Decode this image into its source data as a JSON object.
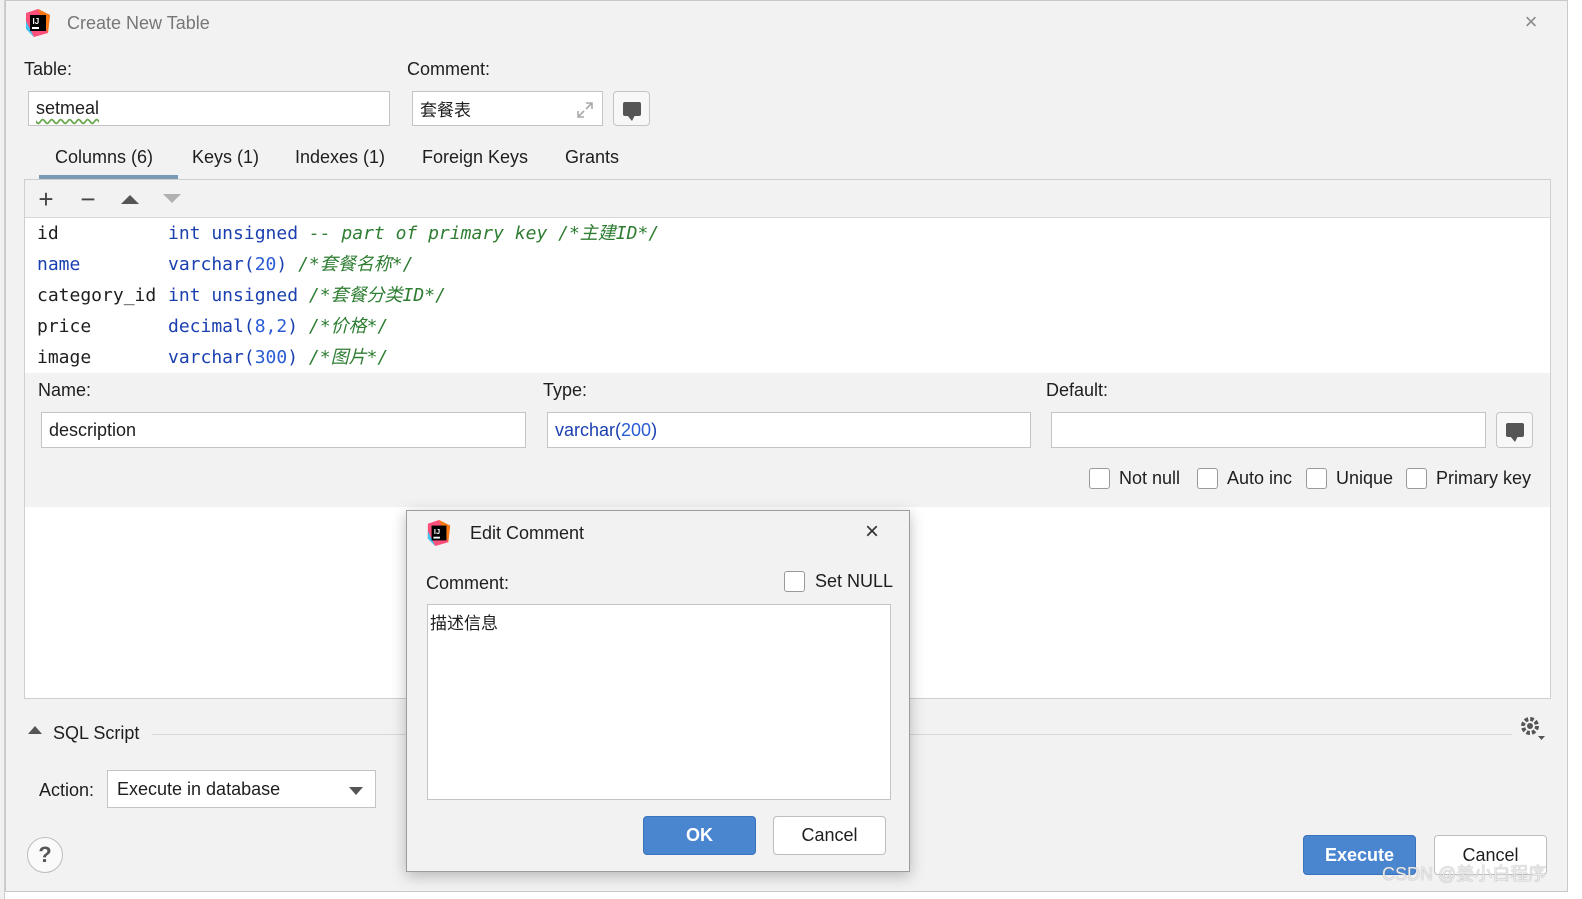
{
  "window": {
    "title": "Create New Table",
    "close_label": "×"
  },
  "table_form": {
    "table_label": "Table:",
    "table_value": "setmeal",
    "comment_label": "Comment:",
    "comment_value": "套餐表"
  },
  "tabs": [
    {
      "label": "Columns (6)",
      "active": true
    },
    {
      "label": "Keys (1)"
    },
    {
      "label": "Indexes (1)"
    },
    {
      "label": "Foreign Keys"
    },
    {
      "label": "Grants"
    }
  ],
  "columns_toolbar": {
    "add": "+",
    "remove": "−"
  },
  "columns": [
    {
      "name": "id",
      "type": "int unsigned",
      "args": "",
      "comment": " -- part of primary key /*主建ID*/",
      "name_highlight": false
    },
    {
      "name": "name",
      "type": "varchar",
      "args": "20",
      "comment": " /*套餐名称*/",
      "name_highlight": true
    },
    {
      "name": "category_id",
      "type": "int unsigned",
      "args": "",
      "comment": " /*套餐分类ID*/",
      "name_highlight": false
    },
    {
      "name": "price",
      "type": "decimal",
      "args": "8,2",
      "comment": " /*价格*/",
      "name_highlight": false
    },
    {
      "name": "image",
      "type": "varchar",
      "args": "300",
      "comment": " /*图片*/",
      "name_highlight": false
    }
  ],
  "column_editor": {
    "name_label": "Name:",
    "name_value": "description",
    "type_label": "Type:",
    "type_value": "varchar",
    "type_args": "200",
    "default_label": "Default:",
    "default_value": "",
    "checkboxes": {
      "not_null": "Not null",
      "auto_inc": "Auto inc",
      "unique": "Unique",
      "primary_key": "Primary key"
    }
  },
  "sql_script": {
    "label": "SQL Script",
    "action_label": "Action:",
    "action_value": "Execute in database"
  },
  "buttons": {
    "help": "?",
    "execute": "Execute",
    "cancel": "Cancel"
  },
  "edit_comment_modal": {
    "title": "Edit Comment",
    "comment_label": "Comment:",
    "set_null_label": "Set NULL",
    "comment_text": "描述信息",
    "ok": "OK",
    "cancel": "Cancel",
    "close_label": "×"
  },
  "watermark": "CSDN @姜小白程序",
  "colors": {
    "accent": "#4a86d0",
    "keyword": "#1a3fb0",
    "comment": "#2e7d32",
    "number": "#2a5cd6"
  }
}
